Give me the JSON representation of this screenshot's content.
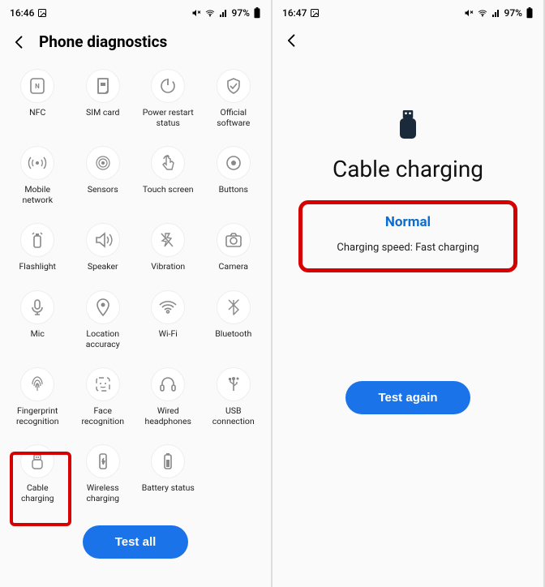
{
  "screen1": {
    "status": {
      "time": "16:46",
      "battery": "97%"
    },
    "title": "Phone diagnostics",
    "tiles": [
      {
        "id": "nfc",
        "label": "NFC"
      },
      {
        "id": "sim",
        "label": "SIM card"
      },
      {
        "id": "restart",
        "label": "Power restart\nstatus"
      },
      {
        "id": "official",
        "label": "Official\nsoftware"
      },
      {
        "id": "mobile",
        "label": "Mobile\nnetwork"
      },
      {
        "id": "sensors",
        "label": "Sensors"
      },
      {
        "id": "touch",
        "label": "Touch screen"
      },
      {
        "id": "buttons",
        "label": "Buttons"
      },
      {
        "id": "flash",
        "label": "Flashlight"
      },
      {
        "id": "speaker",
        "label": "Speaker"
      },
      {
        "id": "vibration",
        "label": "Vibration"
      },
      {
        "id": "camera",
        "label": "Camera"
      },
      {
        "id": "mic",
        "label": "Mic"
      },
      {
        "id": "location",
        "label": "Location\naccuracy"
      },
      {
        "id": "wifi",
        "label": "Wi-Fi"
      },
      {
        "id": "bluetooth",
        "label": "Bluetooth"
      },
      {
        "id": "fingerprint",
        "label": "Fingerprint\nrecognition"
      },
      {
        "id": "face",
        "label": "Face\nrecognition"
      },
      {
        "id": "wiredhp",
        "label": "Wired\nheadphones"
      },
      {
        "id": "usb",
        "label": "USB\nconnection"
      },
      {
        "id": "cablechg",
        "label": "Cable\ncharging"
      },
      {
        "id": "wirelesschg",
        "label": "Wireless\ncharging"
      },
      {
        "id": "battery",
        "label": "Battery status"
      }
    ],
    "button": "Test all"
  },
  "screen2": {
    "status": {
      "time": "16:47",
      "battery": "97%"
    },
    "title": "Cable charging",
    "status_label": "Normal",
    "detail": "Charging speed: Fast charging",
    "button": "Test again"
  }
}
